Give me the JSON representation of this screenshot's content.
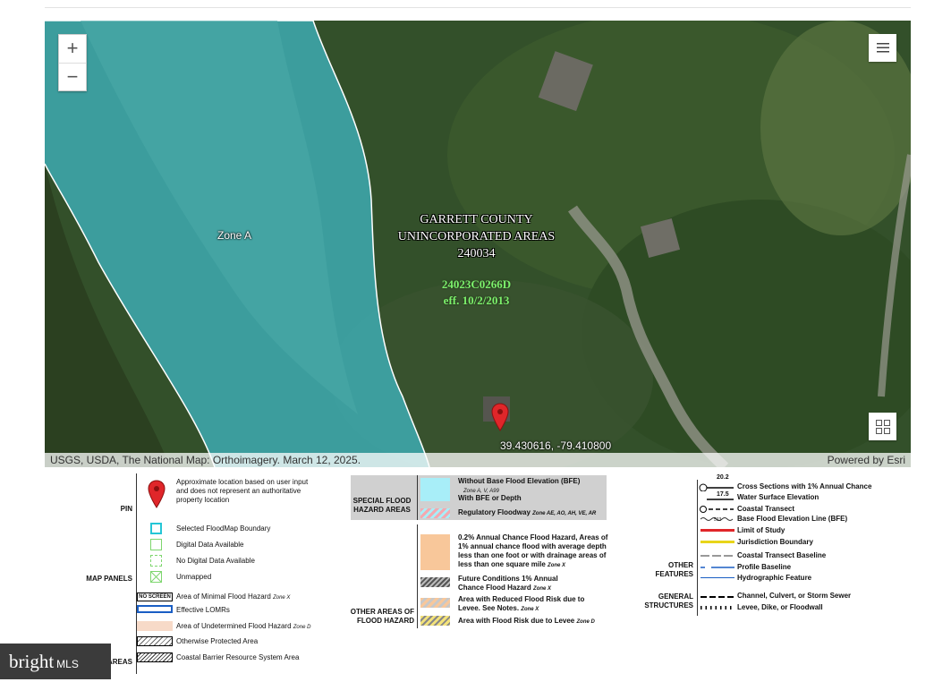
{
  "map": {
    "zoom_in": "+",
    "zoom_out": "−",
    "zone_label": "Zone A",
    "county_line1": "GARRETT COUNTY",
    "county_line2": "UNINCORPORATED AREAS",
    "county_line3": "240034",
    "panel_line1": "24023C0266D",
    "panel_line2": "eff. 10/2/2013",
    "coordinates": "39.430616, -79.410800",
    "attribution": "USGS, USDA, The National Map: Orthoimagery. March 12, 2025.",
    "powered_by": "Powered by Esri",
    "colors": {
      "flood_zone": "#3fb4be",
      "pin": "#e0262a"
    }
  },
  "legend": {
    "pin": {
      "category": "PIN",
      "text": "Approximate location based on user input and does not represent an authoritative property location"
    },
    "map_panels": {
      "category": "MAP PANELS",
      "items": [
        "Selected FloodMap Boundary",
        "Digital Data Available",
        "No Digital Data Available",
        "Unmapped"
      ]
    },
    "other_areas": {
      "category": "AREAS",
      "no_screen": "NO SCREEN",
      "items": [
        {
          "label": "Area of Minimal Flood Hazard",
          "zone": "Zone X"
        },
        {
          "label": "Effective LOMRs",
          "zone": ""
        },
        {
          "label": "Area of Undetermined Flood Hazard",
          "zone": "Zone D"
        },
        {
          "label": "Otherwise Protected Area",
          "zone": ""
        },
        {
          "label": "Coastal Barrier Resource System Area",
          "zone": ""
        }
      ]
    },
    "sfha": {
      "category_line1": "SPECIAL FLOOD",
      "category_line2": "HAZARD AREAS",
      "without_bfe": "Without Base Flood Elevation (BFE)",
      "without_bfe_zone": "Zone A, V, A99",
      "with_bfe": "With BFE or Depth",
      "regulatory": "Regulatory Floodway",
      "regulatory_zone": "Zone AE, AO, AH, VE, AR"
    },
    "other_flood": {
      "category_line1": "OTHER AREAS OF",
      "category_line2": "FLOOD HAZARD",
      "chance_02": "0.2% Annual Chance Flood Hazard, Areas of 1% annual chance flood with average depth less than one foot or with drainage areas of less than one square mile",
      "chance_02_zone": "Zone X",
      "future_line1": "Future Conditions 1% Annual",
      "future_line2": "Chance Flood Hazard",
      "future_zone": "Zone X",
      "reduced_line1": "Area with Reduced Flood Risk due to",
      "reduced_line2": "Levee. See Notes.",
      "reduced_zone": "Zone X",
      "levee_risk": "Area with Flood Risk due to Levee",
      "levee_risk_zone": "Zone D"
    },
    "features": {
      "cross_section_num": "20.2",
      "wse_num": "17.5",
      "bfe_num": "513",
      "cross_sections": "Cross Sections with 1% Annual Chance",
      "water_surface": "Water Surface Elevation",
      "coastal_transect": "Coastal Transect",
      "bfe_line": "Base Flood Elevation Line (BFE)",
      "limit_study": "Limit of Study",
      "jurisdiction": "Jurisdiction Boundary",
      "coastal_baseline": "Coastal Transect Baseline",
      "profile_baseline": "Profile Baseline",
      "hydrographic": "Hydrographic Feature",
      "other_features_line1": "OTHER",
      "other_features_line2": "FEATURES",
      "general_line1": "GENERAL",
      "general_line2": "STRUCTURES",
      "channel": "Channel, Culvert, or Storm Sewer",
      "levee": "Levee, Dike, or Floodwall"
    }
  },
  "watermark": {
    "brand": "bright",
    "suffix": "MLS"
  }
}
